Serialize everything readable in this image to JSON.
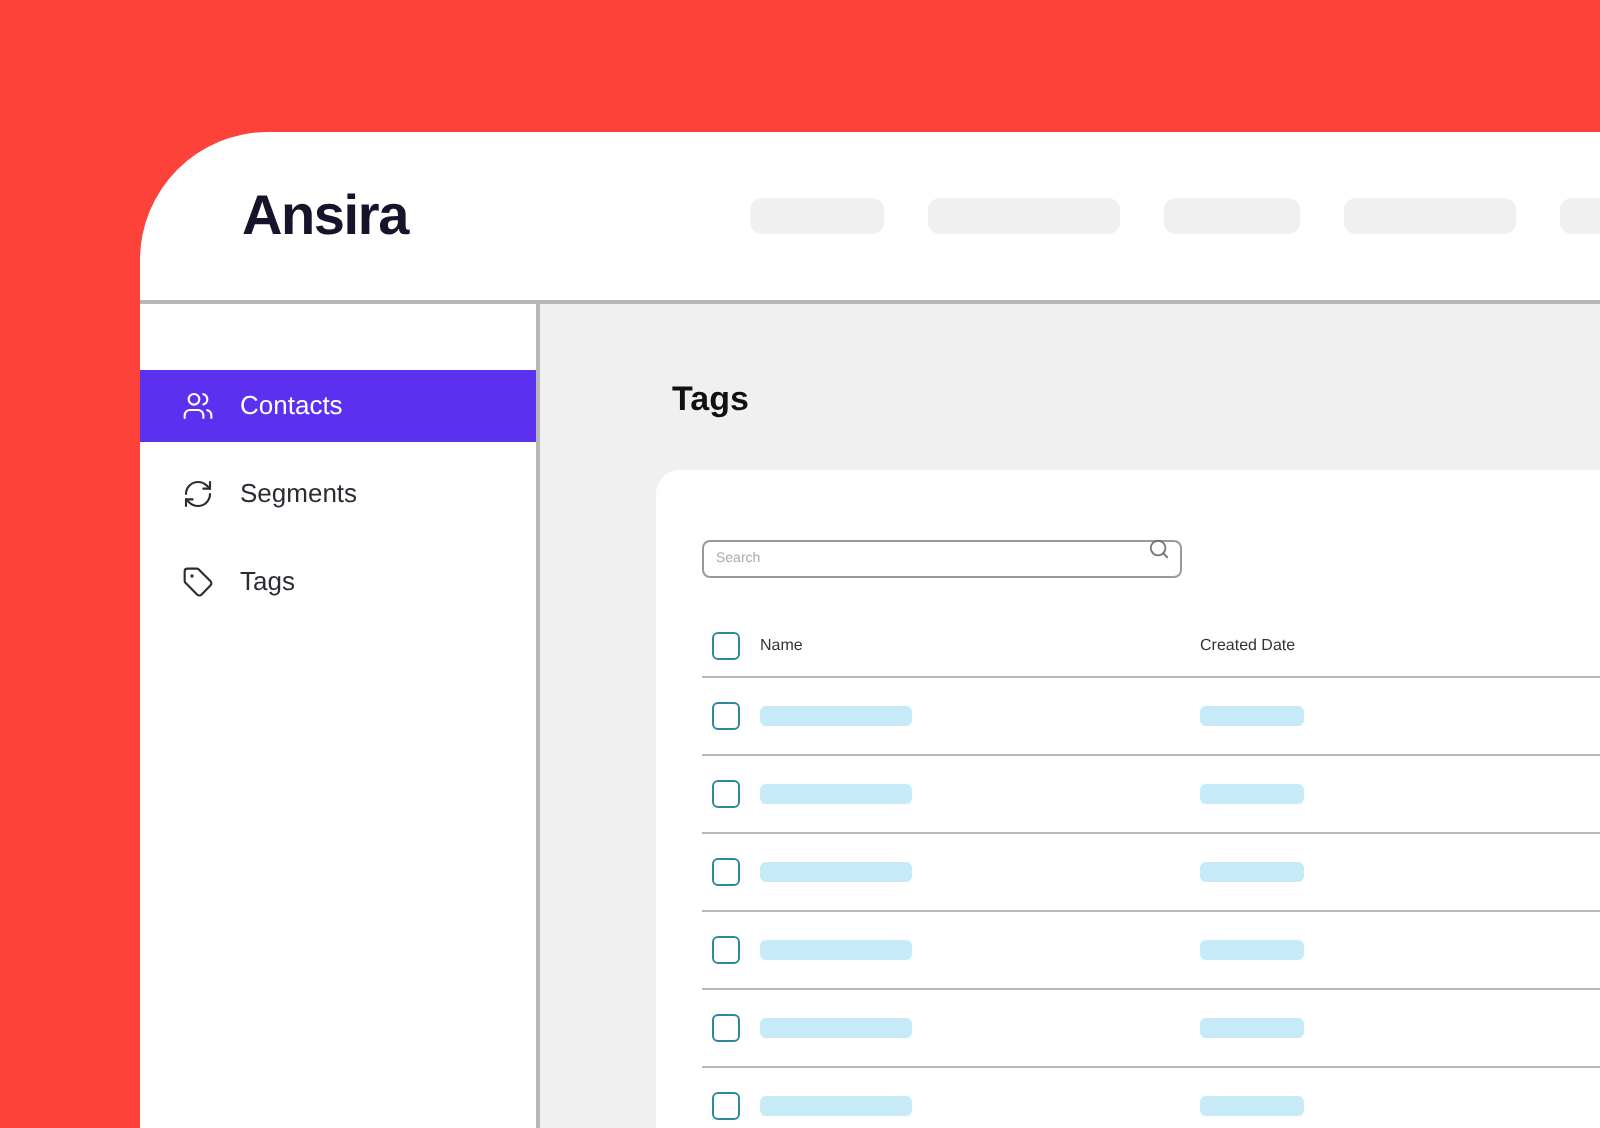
{
  "logo": "Ansira",
  "sidebar": {
    "items": [
      {
        "label": "Contacts",
        "kind": "contacts",
        "selected": true
      },
      {
        "label": "Segments",
        "kind": "segments",
        "selected": false
      },
      {
        "label": "Tags",
        "kind": "tags",
        "selected": false
      }
    ]
  },
  "page_title": "Tags",
  "search": {
    "placeholder": "Search"
  },
  "table": {
    "columns": [
      "Name",
      "Created Date"
    ],
    "header_checked": false,
    "rows": [
      {
        "checked": false
      },
      {
        "checked": false
      },
      {
        "checked": false
      },
      {
        "checked": false
      },
      {
        "checked": false
      },
      {
        "checked": false
      }
    ]
  }
}
